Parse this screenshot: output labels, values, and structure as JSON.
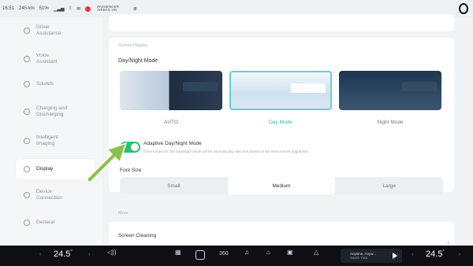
{
  "status_bar": {
    "time": "16:51",
    "range": "245 km",
    "battery": "51%",
    "passenger_airbag_line1": "PASSENGER",
    "passenger_airbag_line2": "AIRBAG ON"
  },
  "sidebar": {
    "items": [
      {
        "label": "Driver\nAssistance",
        "icon": "steering-icon"
      },
      {
        "label": "Voice\nAssistant",
        "icon": "voice-icon"
      },
      {
        "label": "Sounds",
        "icon": "speaker-icon"
      },
      {
        "label": "Charging and\nDischarging",
        "icon": "charging-icon"
      },
      {
        "label": "Intelligent\nImaging",
        "icon": "camera-icon"
      },
      {
        "label": "Display",
        "icon": "display-icon",
        "active": true
      },
      {
        "label": "Device\nConnection",
        "icon": "link-icon"
      },
      {
        "label": "General",
        "icon": "gear-icon"
      }
    ]
  },
  "main": {
    "screen_display_label": "Screen Display",
    "day_night_title": "Day/Night Mode",
    "modes": [
      "AUTO",
      "Day Mode",
      "Night Mode"
    ],
    "selected_mode": "Day Mode",
    "adaptive_title": "Adaptive Day/Night Mode",
    "adaptive_desc": "Once turned on, the Day/Night Mode will be automatically switched based on the environment brightness.",
    "adaptive_on": true,
    "font_size_title": "Font Size",
    "font_sizes": [
      "Small",
      "Medium",
      "Large"
    ],
    "selected_font": "Medium",
    "more_label": "More",
    "screen_cleaning": "Screen Cleaning"
  },
  "dock": {
    "left_temp": "24.5",
    "right_temp": "24.5",
    "degree": "°",
    "music_line1": "Anytime, Anyw...",
    "music_line2": "Sarah Yutu"
  },
  "colors": {
    "accent_teal": "#2fb9b5",
    "toggle_green": "#2ec06c",
    "arrow_green": "#8bc34a"
  }
}
